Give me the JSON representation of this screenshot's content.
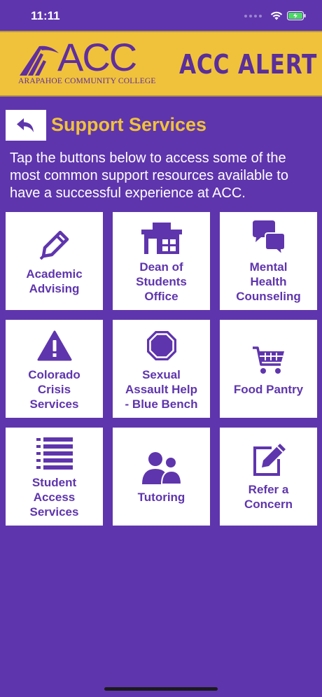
{
  "status_bar": {
    "time": "11:11"
  },
  "banner": {
    "logo_text": "ACC",
    "logo_subtitle": "ARAPAHOE COMMUNITY COLLEGE",
    "alert_title": "ACC ALERT"
  },
  "header": {
    "title": "Support Services"
  },
  "intro": "Tap the buttons below to access some of the most common support resources available to have a successful experience at ACC.",
  "tiles": [
    {
      "label": "Academic\nAdvising",
      "icon": "pencil-icon"
    },
    {
      "label": "Dean of\nStudents\nOffice",
      "icon": "building-icon"
    },
    {
      "label": "Mental\nHealth\nCounseling",
      "icon": "speech-bubbles-icon"
    },
    {
      "label": "Colorado\nCrisis\nServices",
      "icon": "warning-icon"
    },
    {
      "label": "Sexual\nAssault Help\n- Blue Bench",
      "icon": "octagon-icon"
    },
    {
      "label": "Food Pantry",
      "icon": "shopping-cart-icon"
    },
    {
      "label": "Student\nAccess\nServices",
      "icon": "list-icon"
    },
    {
      "label": "Tutoring",
      "icon": "people-icon"
    },
    {
      "label": "Refer a\nConcern",
      "icon": "edit-checkbox-icon"
    }
  ],
  "colors": {
    "background": "#5f35ad",
    "banner": "#f0c23b",
    "title": "#f0c23b",
    "tile_text": "#5f35ad"
  }
}
